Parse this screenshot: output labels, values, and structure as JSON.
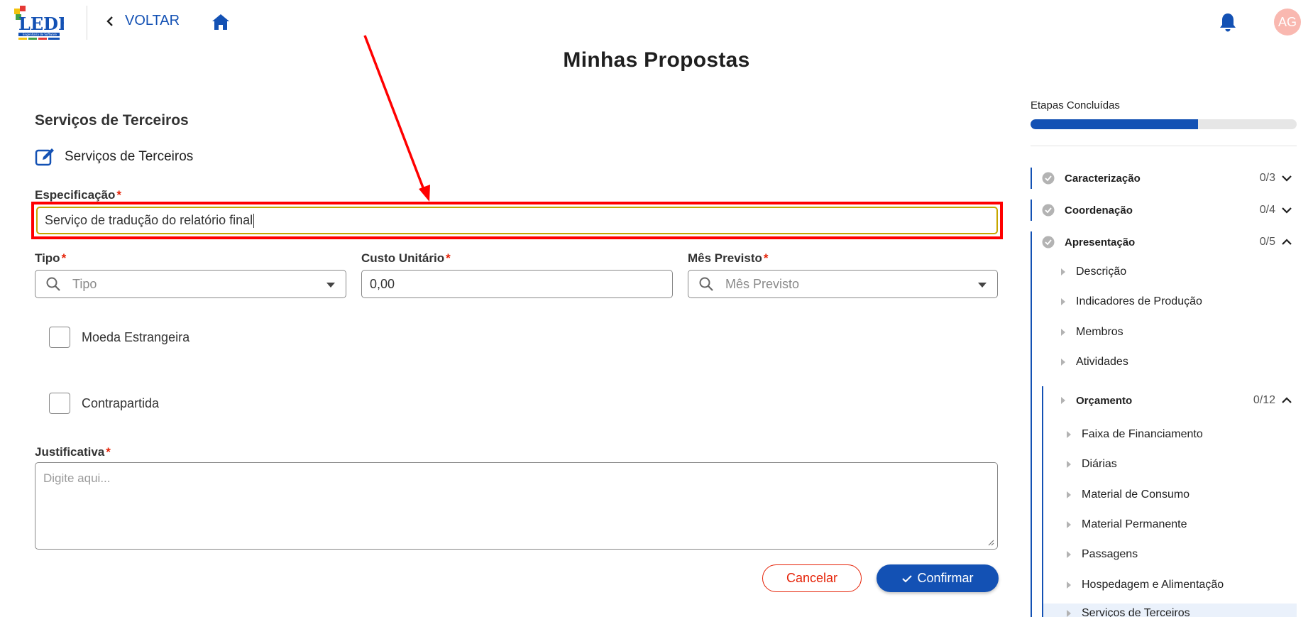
{
  "header": {
    "back_label": "VOLTAR",
    "avatar_initials": "AG",
    "accent_color": "#1351b4"
  },
  "page": {
    "title": "Minhas Propostas"
  },
  "form": {
    "section_title": "Serviços de Terceiros",
    "subsection_title": "Serviços de Terceiros",
    "especificacao": {
      "label": "Especificação",
      "required": "*",
      "value": "Serviço de tradução do relatório final"
    },
    "tipo": {
      "label": "Tipo",
      "required": "*",
      "placeholder": "Tipo"
    },
    "custo_unitario": {
      "label": "Custo Unitário",
      "required": "*",
      "value": "0,00"
    },
    "mes_previsto": {
      "label": "Mês Previsto",
      "required": "*",
      "placeholder": "Mês Previsto"
    },
    "moeda_estrangeira": {
      "label": "Moeda Estrangeira",
      "checked": false
    },
    "contrapartida": {
      "label": "Contrapartida",
      "checked": false
    },
    "justificativa": {
      "label": "Justificativa",
      "required": "*",
      "placeholder": "Digite aqui..."
    },
    "cancel_label": "Cancelar",
    "confirm_label": "Confirmar"
  },
  "sidebar": {
    "progress_label": "Etapas Concluídas",
    "progress_fraction": 0.63,
    "steps": [
      {
        "label": "Caracterização",
        "count": "0/3",
        "expanded": false
      },
      {
        "label": "Coordenação",
        "count": "0/4",
        "expanded": false
      },
      {
        "label": "Apresentação",
        "count": "0/5",
        "expanded": true
      }
    ],
    "apresentacao_items": [
      {
        "label": "Descrição"
      },
      {
        "label": "Indicadores de Produção"
      },
      {
        "label": "Membros"
      },
      {
        "label": "Atividades"
      }
    ],
    "orcamento": {
      "label": "Orçamento",
      "count": "0/12",
      "items": [
        {
          "label": "Faixa de Financiamento"
        },
        {
          "label": "Diárias"
        },
        {
          "label": "Material de Consumo"
        },
        {
          "label": "Material Permanente"
        },
        {
          "label": "Passagens"
        },
        {
          "label": "Hospedagem e Alimentação"
        },
        {
          "label": "Serviços de Terceiros"
        }
      ]
    }
  }
}
